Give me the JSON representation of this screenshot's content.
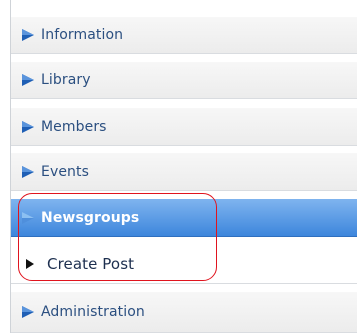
{
  "menu": {
    "items": [
      {
        "label": "Information",
        "icon": "play-arrow-icon"
      },
      {
        "label": "Library",
        "icon": "play-arrow-icon"
      },
      {
        "label": "Members",
        "icon": "play-arrow-icon"
      },
      {
        "label": "Events",
        "icon": "play-arrow-icon"
      },
      {
        "label": "Newsgroups",
        "icon": "play-arrow-icon",
        "active": true
      },
      {
        "label": "Administration",
        "icon": "play-arrow-icon"
      }
    ],
    "subitem": {
      "label": "Create Post",
      "icon": "triangle-right-icon"
    }
  },
  "colors": {
    "accent": "#3d86dc",
    "arrow": "#1f5fb5",
    "highlight_ring": "#e0141e"
  }
}
